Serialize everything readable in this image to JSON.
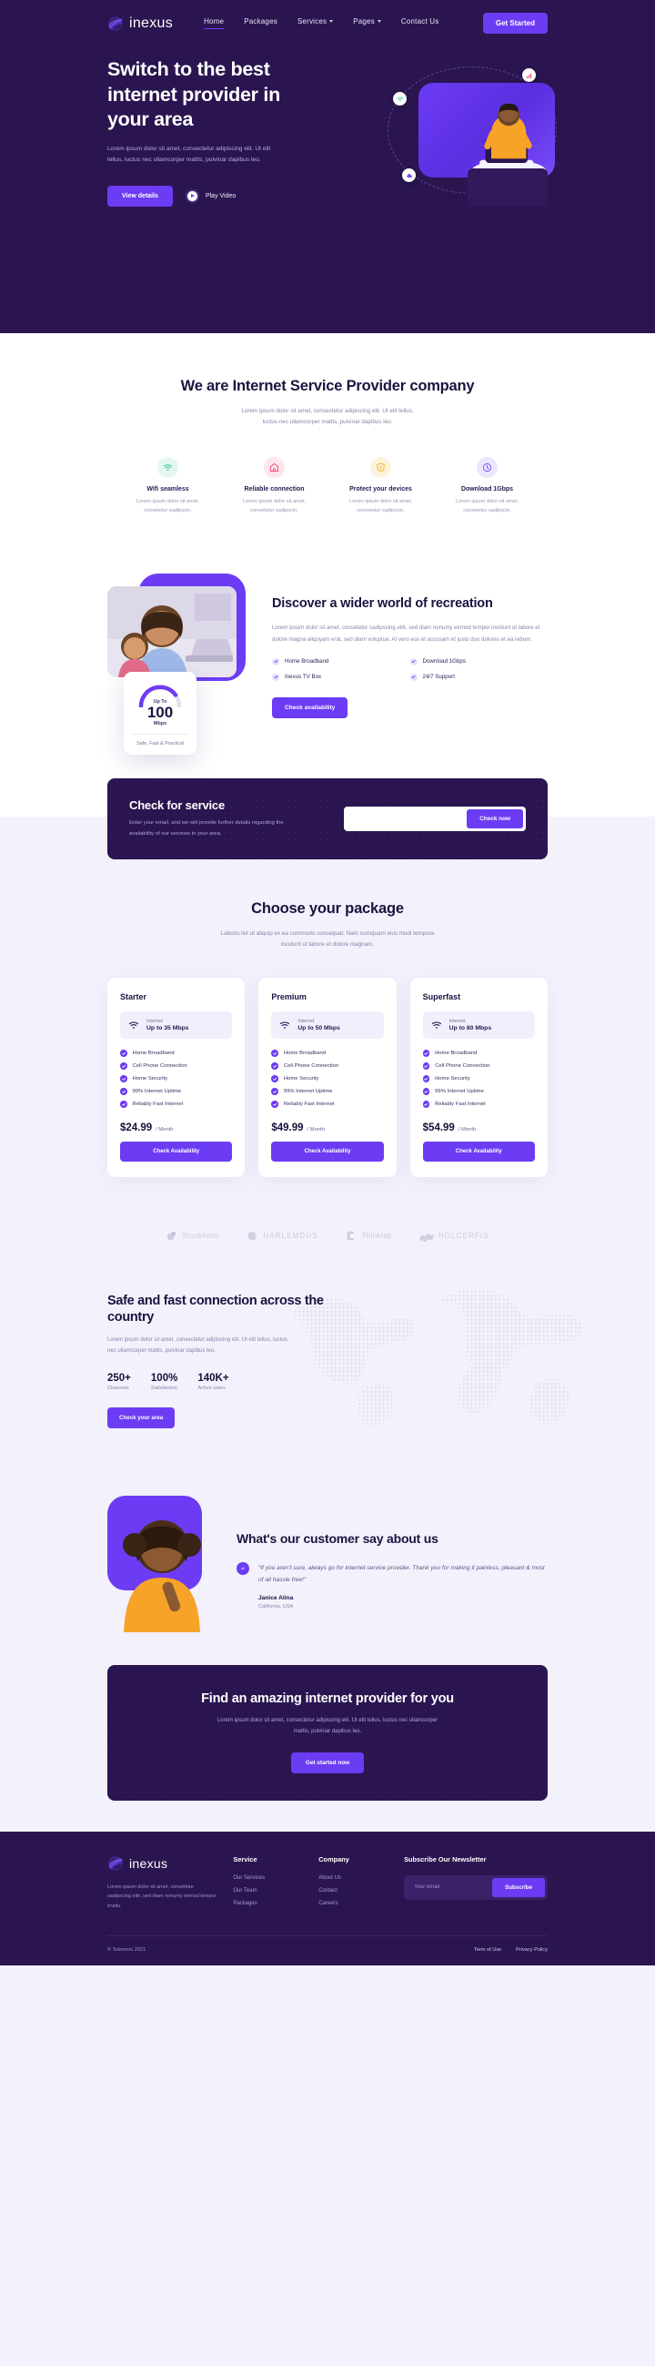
{
  "brand": {
    "name": "inexus",
    "logo_icon": "globe-swirl-icon"
  },
  "nav": {
    "links": [
      {
        "label": "Home",
        "active": true,
        "caret": false
      },
      {
        "label": "Packages",
        "active": false,
        "caret": false
      },
      {
        "label": "Services",
        "active": false,
        "caret": true
      },
      {
        "label": "Pages",
        "active": false,
        "caret": true
      },
      {
        "label": "Contact Us",
        "active": false,
        "caret": false
      }
    ],
    "cta_label": "Get Started"
  },
  "hero": {
    "title": "Switch to the best internet provider in your area",
    "subtitle": "Lorem ipsum dolor sit amet, consectetur adipiscing elit. Ut elit tellus, luctus nec ullamcorper mattis, pulvinar dapibus leo.",
    "primary_button": "View details",
    "video_label": "Play Video",
    "badges": [
      "wifi-icon",
      "signal-icon",
      "cloud-icon"
    ]
  },
  "features_section": {
    "title": "We are Internet Service Provider company",
    "subtitle": "Lorem ipsum dolor sit amet, consectetur adipiscing elit. Ut elit tellus, luctus nec ullamcorper mattis, pulvinar dapibus leo.",
    "items": [
      {
        "icon": "wifi-icon",
        "color": "#2fbf8f",
        "bg": "#e4f7ef",
        "name": "Wifi seamless",
        "desc": "Lorem ipsum dolor sit amet, consetetur sadipscin."
      },
      {
        "icon": "home-icon",
        "color": "#f0446b",
        "bg": "#fde7ed",
        "name": "Reliable connection",
        "desc": "Lorem ipsum dolor sit amet, consetetur sadipscin."
      },
      {
        "icon": "shield-lock-icon",
        "color": "#f2b11c",
        "bg": "#fdf3dd",
        "name": "Protect your devices",
        "desc": "Lorem ipsum dolor sit amet, consetetur sadipscin."
      },
      {
        "icon": "download-speed-icon",
        "color": "#7a4cf8",
        "bg": "#ece6fd",
        "name": "Download 1Gbps",
        "desc": "Lorem ipsum dolor sit amet, consetetur sadipscin."
      }
    ]
  },
  "discover": {
    "title": "Discover a wider world of recreation",
    "paragraph": "Lorem ipsum dolor sit amet, consetetur sadipscing elitr, sed diam nonumy eirmod tempor invidunt ut labore et dolore magna aliquyam erat, sed diam voluptua. At vero eos et accusam et justo duo dolores et ea rebum.",
    "checklist": [
      "Home Broadband",
      "Download 1Gbps",
      "Inexus TV Box",
      "24/7 Support"
    ],
    "button": "Check availability",
    "speed_card": {
      "upto": "Up To",
      "value": "100",
      "unit": "Mbps",
      "tagline": "Safe, Fast & Practical"
    }
  },
  "service_check": {
    "title": "Check for service",
    "desc": "Enter your email, and we will provide further details regarding the availability of our services in your area.",
    "input_value": "",
    "input_placeholder": "",
    "button": "Check now"
  },
  "packages": {
    "title": "Choose your package",
    "subtitle": "Laboris list ut aliquip ex ea commodo consequat. Nam numquam eius modi tempora incidunt ut labore et dolore magnam.",
    "speed_caption": "Internet",
    "features": [
      "Home Broadband",
      "Cell Phone Connection",
      "Home Security",
      "99% Internet Uptime",
      "Reliably Fast Internet"
    ],
    "period": "/ Month",
    "button": "Check Availability",
    "cards": [
      {
        "name": "Starter",
        "speed": "Up to 35 Mbps",
        "price": "$24.99"
      },
      {
        "name": "Premium",
        "speed": "Up to 50 Mbps",
        "price": "$49.99"
      },
      {
        "name": "Superfast",
        "speed": "Up to 80 Mbps",
        "price": "$54.99"
      }
    ]
  },
  "brands": [
    {
      "name": "Stockholm",
      "caps": false
    },
    {
      "name": "HARLEMDUS",
      "caps": true
    },
    {
      "name": "Thinklab",
      "caps": false
    },
    {
      "name": "HOLCERFIS",
      "caps": true
    }
  ],
  "safe": {
    "title": "Safe and fast connection across the country",
    "paragraph": "Lorem ipsum dolor sit amet, consectetur adipiscing elit. Ut elit tellus, luctus nec ullamcorper mattis, pulvinar dapibus leo.",
    "stats": [
      {
        "value": "250+",
        "label": "Channels"
      },
      {
        "value": "100%",
        "label": "Satisfaction"
      },
      {
        "value": "140K+",
        "label": "Active users"
      }
    ],
    "button": "Check your area"
  },
  "testimonial": {
    "title": "What's our customer say about us",
    "quote": "“If you aren't sure, always go for internet service provider. Thank you for making it painless, pleasant & most of all hassle free!”",
    "author": "Janice Alina",
    "location": "California, USA",
    "quote_icon": "quotation-mark-icon"
  },
  "cta": {
    "title": "Find an amazing internet provider for you",
    "subtitle": "Lorem ipsum dolor sit amet, consectetur adipiscing elit. Ut elit tellus, luctus nec ullamcorper mattis, pulvinar dapibus leo.",
    "button": "Get started now"
  },
  "footer": {
    "brand_desc": "Lorem ipsum dolor sit amet, consetetur sadipscing elitr, sed diam nonumy eirmod tempor invidu.",
    "columns": [
      {
        "title": "Service",
        "links": [
          "Our Services",
          "Our Team",
          "Packages"
        ]
      },
      {
        "title": "Company",
        "links": [
          "About Us",
          "Contact",
          "Careers"
        ]
      }
    ],
    "newsletter": {
      "title": "Subscribe Our Newsletter",
      "placeholder": "Your email",
      "value": "",
      "button": "Subscribe"
    },
    "copyright": "© Tokomoo 2021",
    "legal": [
      "Term of Use",
      "Privacy Policy"
    ]
  },
  "colors": {
    "accent": "#6c3cf4",
    "dark": "#2a1550",
    "page_bg": "#f3f1fb"
  }
}
